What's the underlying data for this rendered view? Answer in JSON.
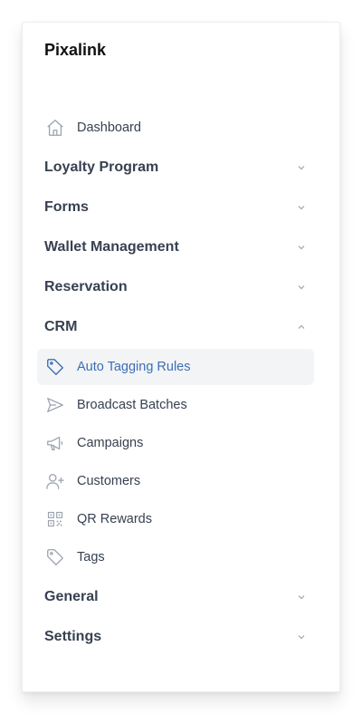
{
  "app": {
    "title": "Pixalink"
  },
  "colors": {
    "accent": "#3b6fb6",
    "text": "#374151",
    "icon": "#9ca3af",
    "active_bg": "#f3f4f6"
  },
  "nav": {
    "dashboard": {
      "label": "Dashboard",
      "icon": "home-icon"
    },
    "sections": {
      "loyalty": {
        "label": "Loyalty Program",
        "expanded": false
      },
      "forms": {
        "label": "Forms",
        "expanded": false
      },
      "wallet": {
        "label": "Wallet Management",
        "expanded": false
      },
      "reservation": {
        "label": "Reservation",
        "expanded": false
      },
      "crm": {
        "label": "CRM",
        "expanded": true,
        "items": [
          {
            "label": "Auto Tagging Rules",
            "icon": "tag-icon",
            "active": true
          },
          {
            "label": "Broadcast Batches",
            "icon": "send-icon",
            "active": false
          },
          {
            "label": "Campaigns",
            "icon": "megaphone-icon",
            "active": false
          },
          {
            "label": "Customers",
            "icon": "user-plus-icon",
            "active": false
          },
          {
            "label": "QR Rewards",
            "icon": "qr-code-icon",
            "active": false
          },
          {
            "label": "Tags",
            "icon": "tag-icon",
            "active": false
          }
        ]
      },
      "general": {
        "label": "General",
        "expanded": false
      },
      "settings": {
        "label": "Settings",
        "expanded": false
      }
    }
  }
}
